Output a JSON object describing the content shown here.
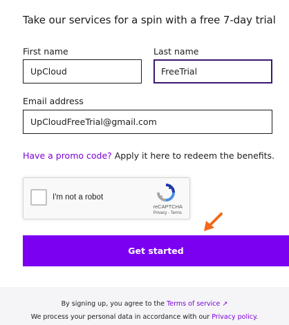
{
  "heading": "Take our services for a spin with a free 7-day trial",
  "form": {
    "first_name": {
      "label": "First name",
      "value": "UpCloud"
    },
    "last_name": {
      "label": "Last name",
      "value": "FreeTrial"
    },
    "email": {
      "label": "Email address",
      "value": "UpCloudFreeTrial@gmail.com"
    }
  },
  "promo": {
    "link": "Have a promo code?",
    "text": " Apply it here to redeem the benefits."
  },
  "recaptcha": {
    "label": "I'm not a robot",
    "brand": "reCAPTCHA",
    "links": "Privacy - Terms",
    "icon": "recaptcha-logo-icon"
  },
  "cta": {
    "label": "Get started"
  },
  "annotation": {
    "icon": "orange-pointer-arrow-icon",
    "color": "#f26a1b"
  },
  "footer": {
    "line1_prefix": "By signing up, you agree to the ",
    "terms_link": "Terms of service ↗",
    "line2_prefix": "We process your personal data in accordance with our ",
    "privacy_link": "Privacy policy",
    "line2_suffix": "."
  },
  "colors": {
    "accent": "#7b00f2",
    "link": "#7b00d9",
    "focus_border": "#3a1670",
    "footer_bg": "#f5f5f7"
  }
}
